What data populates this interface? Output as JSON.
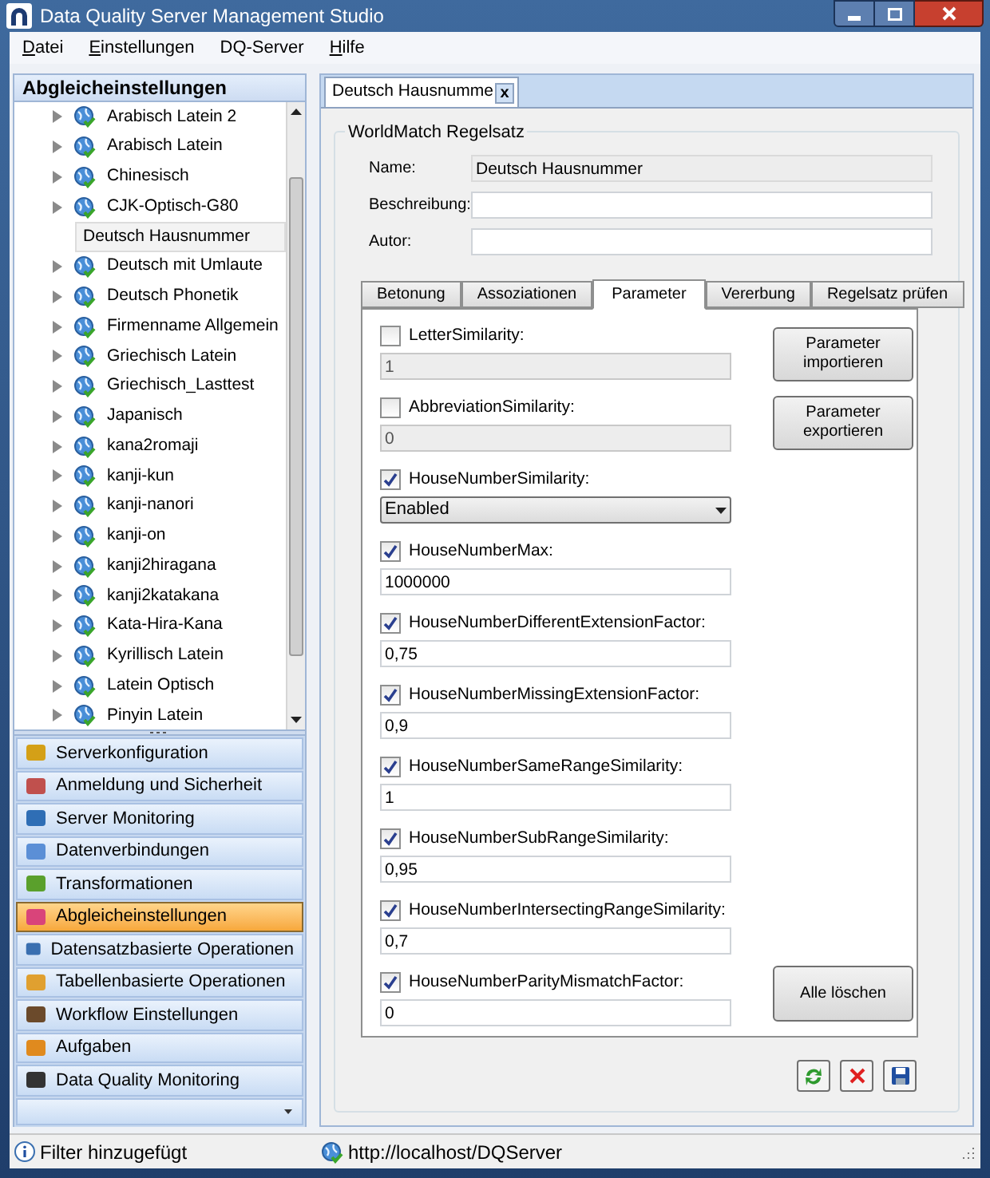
{
  "window": {
    "title": "Data Quality Server Management Studio"
  },
  "menu": [
    {
      "label": "Datei",
      "underlined": true
    },
    {
      "label": "Einstellungen",
      "underlined": true
    },
    {
      "label": "DQ-Server",
      "underlined": false
    },
    {
      "label": "Hilfe",
      "underlined": true
    }
  ],
  "left_panel": {
    "title": "Abgleicheinstellungen"
  },
  "tree": [
    {
      "label": "Arabisch Latein 2",
      "selected": false
    },
    {
      "label": "Arabisch Latein",
      "selected": false
    },
    {
      "label": "Chinesisch",
      "selected": false
    },
    {
      "label": "CJK-Optisch-G80",
      "selected": false
    },
    {
      "label": "Deutsch Hausnummer",
      "selected": true
    },
    {
      "label": "Deutsch mit Umlaute",
      "selected": false
    },
    {
      "label": "Deutsch Phonetik",
      "selected": false
    },
    {
      "label": "Firmenname Allgemein",
      "selected": false
    },
    {
      "label": "Griechisch Latein",
      "selected": false
    },
    {
      "label": "Griechisch_Lasttest",
      "selected": false
    },
    {
      "label": "Japanisch",
      "selected": false
    },
    {
      "label": "kana2romaji",
      "selected": false
    },
    {
      "label": "kanji-kun",
      "selected": false
    },
    {
      "label": "kanji-nanori",
      "selected": false
    },
    {
      "label": "kanji-on",
      "selected": false
    },
    {
      "label": "kanji2hiragana",
      "selected": false
    },
    {
      "label": "kanji2katakana",
      "selected": false
    },
    {
      "label": "Kata-Hira-Kana",
      "selected": false
    },
    {
      "label": "Kyrillisch Latein",
      "selected": false
    },
    {
      "label": "Latein Optisch",
      "selected": false
    },
    {
      "label": "Pinyin Latein",
      "selected": false
    }
  ],
  "nav": [
    {
      "label": "Serverkonfiguration",
      "selected": false,
      "color": "#d4a017"
    },
    {
      "label": "Anmeldung und Sicherheit",
      "selected": false,
      "color": "#c0504d"
    },
    {
      "label": "Server Monitoring",
      "selected": false,
      "color": "#2f6eb5"
    },
    {
      "label": "Datenverbindungen",
      "selected": false,
      "color": "#5b8fd6"
    },
    {
      "label": "Transformationen",
      "selected": false,
      "color": "#5aa02c"
    },
    {
      "label": "Abgleicheinstellungen",
      "selected": true,
      "color": "#d9447a"
    },
    {
      "label": "Datensatzbasierte Operationen",
      "selected": false,
      "color": "#3a6fb0"
    },
    {
      "label": "Tabellenbasierte Operationen",
      "selected": false,
      "color": "#e0a030"
    },
    {
      "label": "Workflow Einstellungen",
      "selected": false,
      "color": "#6b4a2b"
    },
    {
      "label": "Aufgaben",
      "selected": false,
      "color": "#e08a1e"
    },
    {
      "label": "Data Quality Monitoring",
      "selected": false,
      "color": "#333333"
    }
  ],
  "document_tabs": [
    {
      "label": "Deutsch Hausnumme",
      "selected": true,
      "close": "x"
    }
  ],
  "group": {
    "title": "WorldMatch Regelsatz"
  },
  "fields": [
    {
      "label": "Name:",
      "value": "Deutsch Hausnummer",
      "disabled": true
    },
    {
      "label": "Beschreibung:",
      "disabled": false
    },
    {
      "label": "Autor:",
      "disabled": false
    }
  ],
  "inner_tabs": [
    {
      "label": "Betonung",
      "selected": false
    },
    {
      "label": "Assoziationen",
      "selected": false
    },
    {
      "label": "Parameter",
      "selected": true
    },
    {
      "label": "Vererbung",
      "selected": false
    },
    {
      "label": "Regelsatz prüfen",
      "selected": false
    }
  ],
  "parameters": [
    {
      "kind": "input",
      "label": "LetterSimilarity:",
      "checked": false,
      "value": "1"
    },
    {
      "kind": "input",
      "label": "AbbreviationSimilarity:",
      "checked": false,
      "value": "0"
    },
    {
      "kind": "select",
      "label": "HouseNumberSimilarity:",
      "checked": true,
      "value": "Enabled"
    },
    {
      "kind": "input",
      "label": "HouseNumberMax:",
      "checked": true,
      "value": "1000000"
    },
    {
      "kind": "input",
      "label": "HouseNumberDifferentExtensionFactor:",
      "checked": true,
      "value": "0,75"
    },
    {
      "kind": "input",
      "label": "HouseNumberMissingExtensionFactor:",
      "checked": true,
      "value": "0,9"
    },
    {
      "kind": "input",
      "label": "HouseNumberSameRangeSimilarity:",
      "checked": true,
      "value": "1"
    },
    {
      "kind": "input",
      "label": "HouseNumberSubRangeSimilarity:",
      "checked": true,
      "value": "0,95"
    },
    {
      "kind": "input",
      "label": "HouseNumberIntersectingRangeSimilarity:",
      "checked": true,
      "value": "0,7"
    },
    {
      "kind": "input",
      "label": "HouseNumberParityMismatchFactor:",
      "checked": true,
      "value": "0"
    }
  ],
  "side_buttons": [
    "Parameter importieren",
    "Parameter exportieren"
  ],
  "clear_button": "Alle löschen",
  "status_bar": {
    "message": "Filter hinzugefügt",
    "url": "http://localhost/DQServer"
  }
}
